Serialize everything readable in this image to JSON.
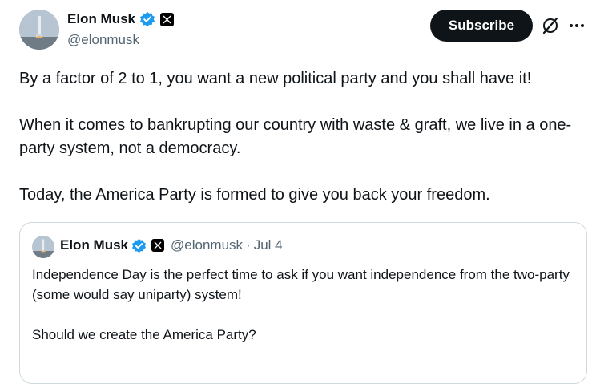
{
  "author": {
    "display_name": "Elon Musk",
    "handle": "@elonmusk"
  },
  "actions": {
    "subscribe_label": "Subscribe"
  },
  "tweet": {
    "paragraphs": [
      "By a factor of 2 to 1, you want a new political party and you shall have it!",
      "When it comes to bankrupting our country with waste & graft, we live in a one-party system, not a democracy.",
      "Today, the America Party is formed to give you back your freedom."
    ]
  },
  "quoted": {
    "display_name": "Elon Musk",
    "handle": "@elonmusk",
    "separator": "·",
    "date": "Jul 4",
    "paragraphs": [
      "Independence Day is the perfect time to ask if you want independence from the two-party (some would say uniparty) system!",
      "Should we create the America Party?"
    ]
  },
  "colors": {
    "verified_blue": "#1d9bf0",
    "text_primary": "#0f1419",
    "text_secondary": "#536471",
    "border": "#cfd9de"
  },
  "icons": [
    "verified-badge-icon",
    "x-logo-icon",
    "grok-icon",
    "more-icon"
  ]
}
